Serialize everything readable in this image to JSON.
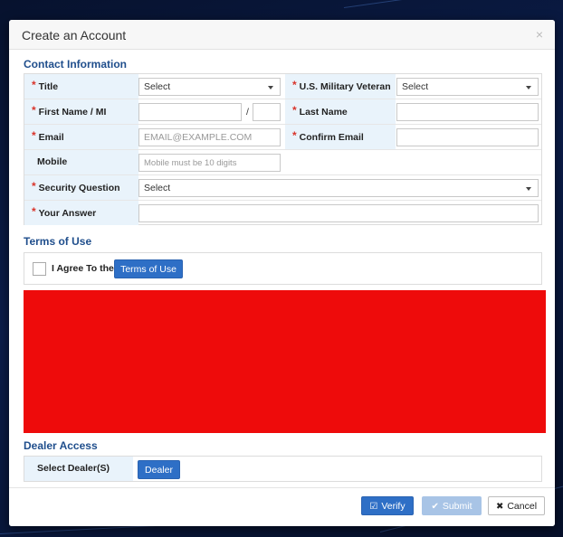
{
  "dialog": {
    "title": "Create an Account",
    "close_glyph": "×"
  },
  "contact": {
    "section_title": "Contact Information",
    "title_label": "Title",
    "title_value": "Select",
    "veteran_label": "U.S. Military Veteran",
    "veteran_value": "Select",
    "first_name_label": "First Name / MI",
    "first_name_value": "",
    "mi_separator": "/",
    "mi_value": "",
    "last_name_label": "Last Name",
    "last_name_value": "",
    "email_label": "Email",
    "email_placeholder": "EMAIL@EXAMPLE.COM",
    "confirm_email_label": "Confirm Email",
    "confirm_email_value": "",
    "mobile_label": "Mobile",
    "mobile_placeholder": "Mobile must be 10 digits",
    "security_question_label": "Security Question",
    "security_question_value": "Select",
    "answer_label": "Your Answer",
    "answer_value": "",
    "required_marker": "*"
  },
  "terms": {
    "section_title": "Terms of Use",
    "agree_label": "I Agree To the",
    "agree_checked": false,
    "terms_button": "Terms of Use"
  },
  "dealer": {
    "section_title": "Dealer Access",
    "select_label": "Select Dealer(S)",
    "dealer_button": "Dealer"
  },
  "footer": {
    "verify_label": "Verify",
    "submit_label": "Submit",
    "cancel_label": "Cancel"
  },
  "colors": {
    "accent": "#2e6fc6",
    "section_title": "#1f4e8c",
    "label_bg": "#e9f3fb",
    "required": "#d9342b",
    "redacted_block": "#ee0b0b"
  }
}
